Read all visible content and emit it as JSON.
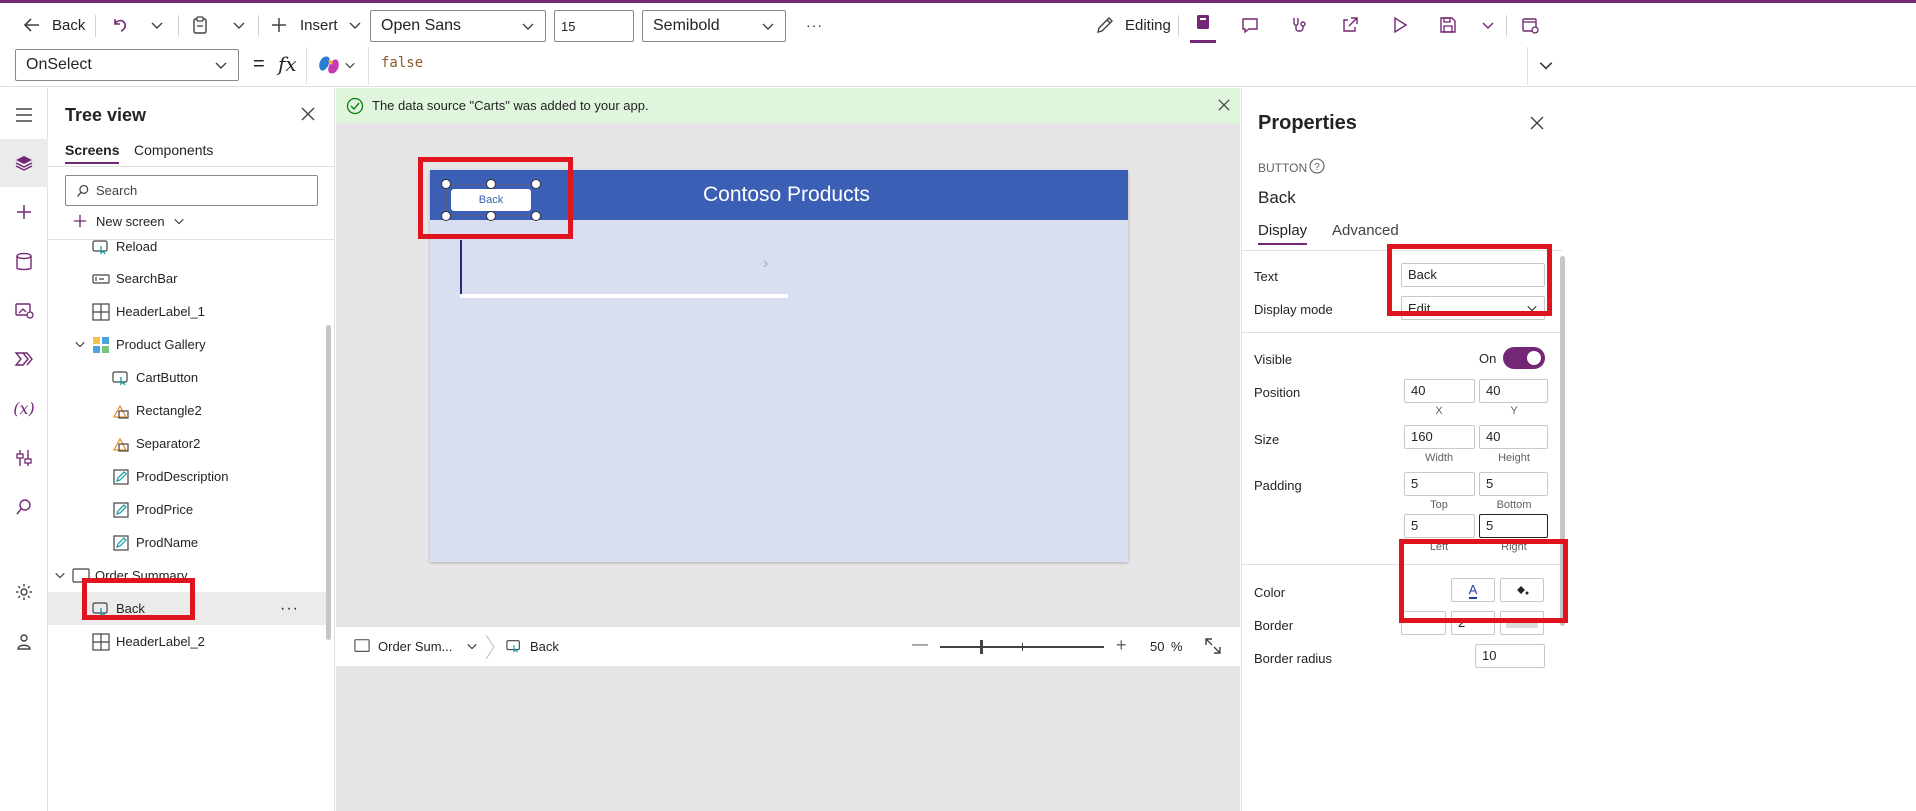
{
  "toolbar": {
    "back_label": "Back",
    "insert_label": "Insert",
    "font_family": "Open Sans",
    "font_size": "15",
    "font_weight": "Semibold",
    "more_label": "···",
    "editing_label": "Editing"
  },
  "formula": {
    "property": "OnSelect",
    "equals": "=",
    "fx": "fx",
    "value": "false"
  },
  "tree": {
    "title": "Tree view",
    "tabs": [
      "Screens",
      "Components"
    ],
    "search_placeholder": "Search",
    "new_screen_label": "New screen",
    "items": [
      {
        "label": "Reload",
        "icon": "button-icon"
      },
      {
        "label": "SearchBar",
        "icon": "input-icon"
      },
      {
        "label": "HeaderLabel_1",
        "icon": "label-icon"
      },
      {
        "label": "Product Gallery",
        "icon": "gallery-icon"
      },
      {
        "label": "CartButton",
        "icon": "button-icon"
      },
      {
        "label": "Rectangle2",
        "icon": "shape-icon"
      },
      {
        "label": "Separator2",
        "icon": "shape-icon"
      },
      {
        "label": "ProdDescription",
        "icon": "text-icon"
      },
      {
        "label": "ProdPrice",
        "icon": "text-icon"
      },
      {
        "label": "ProdName",
        "icon": "text-icon"
      },
      {
        "label": "Order Summary",
        "icon": "screen-icon"
      },
      {
        "label": "Back",
        "icon": "button-icon"
      },
      {
        "label": "HeaderLabel_2",
        "icon": "label-icon"
      }
    ],
    "more_label": "···"
  },
  "banner": {
    "message": "The data source \"Carts\" was added to your app."
  },
  "canvas": {
    "header_title": "Contoso Products",
    "back_button_label": "Back",
    "chevron": "›"
  },
  "statusbar": {
    "screen_label": "Order Sum...",
    "control_label": "Back",
    "zoom_value": "50",
    "zoom_unit": "%"
  },
  "properties": {
    "title": "Properties",
    "type_label": "BUTTON",
    "control_name": "Back",
    "tabs": [
      "Display",
      "Advanced"
    ],
    "text_label": "Text",
    "text_value": "Back",
    "display_mode_label": "Display mode",
    "display_mode_value": "Edit",
    "visible_label": "Visible",
    "visible_state": "On",
    "position_label": "Position",
    "position_x": "40",
    "position_y": "40",
    "x_label": "X",
    "y_label": "Y",
    "size_label": "Size",
    "width_value": "160",
    "height_value": "40",
    "width_label": "Width",
    "height_label": "Height",
    "padding_label": "Padding",
    "padding_top": "5",
    "padding_bottom": "5",
    "padding_left": "5",
    "padding_right": "5",
    "top_label": "Top",
    "bottom_label": "Bottom",
    "left_label": "Left",
    "right_label": "Right",
    "color_label": "Color",
    "color_a": "A",
    "border_label": "Border",
    "border_value": "2",
    "border_radius_label": "Border radius",
    "border_radius_value": "10"
  },
  "colors": {
    "accent": "#742774",
    "header_blue": "#3a5fb4",
    "annotation_red": "#e0141e"
  }
}
